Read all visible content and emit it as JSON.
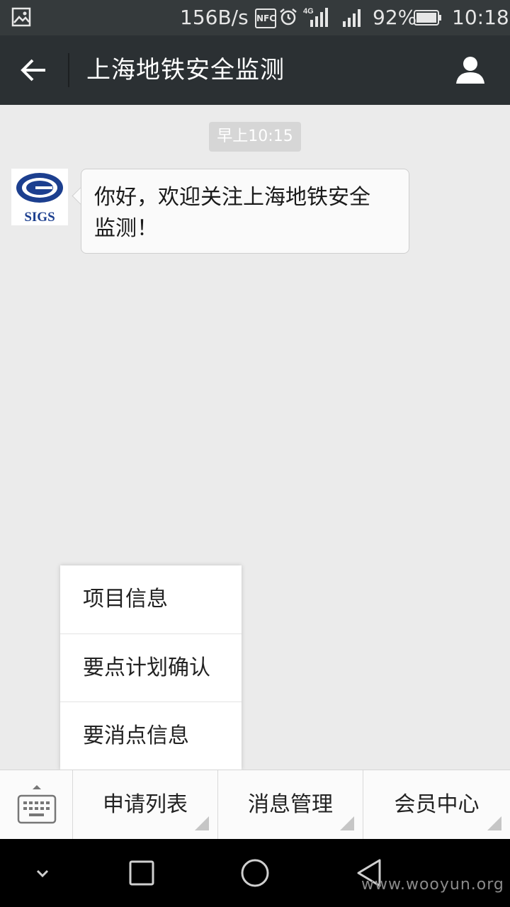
{
  "status_bar": {
    "speed": "156B/s",
    "nfc": "NFC",
    "network": "4G",
    "battery": "92%",
    "time": "10:18",
    "icons": [
      "image-icon",
      "nfc-icon",
      "alarm-icon",
      "signal-4g-icon",
      "signal-icon",
      "battery-icon"
    ]
  },
  "header": {
    "title": "上海地铁安全监测",
    "back_icon": "arrow-left-icon",
    "profile_icon": "person-icon"
  },
  "chat": {
    "timestamp": "早上10:15",
    "message_line1": "你好，欢迎关注上海地铁安全",
    "message_line2": "监测！",
    "avatar_text": "SIGS"
  },
  "popup_menu": {
    "items": [
      "项目信息",
      "要点计划确认",
      "要消点信息"
    ]
  },
  "bottom_menu": {
    "keyboard_icon": "keyboard-icon",
    "tabs": [
      "申请列表",
      "消息管理",
      "会员中心"
    ]
  },
  "nav": {
    "icons": [
      "chevron-down-icon",
      "square-icon",
      "circle-icon",
      "triangle-back-icon"
    ]
  },
  "watermark": "www.wooyun.org",
  "colors": {
    "header_bg": "#2b3033",
    "status_bg": "#353a3c",
    "chat_bg": "#ebebeb",
    "logo_blue": "#1c3f8f"
  }
}
